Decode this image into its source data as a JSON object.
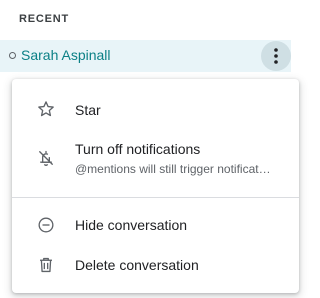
{
  "section": {
    "title": "RECENT"
  },
  "room": {
    "name": "Sarah Aspinall"
  },
  "menu": {
    "items": [
      {
        "label": "Star",
        "icon": "star-outline-icon"
      },
      {
        "label": "Turn off notifications",
        "sublabel": "@mentions will still trigger notifications",
        "icon": "bell-off-icon"
      },
      {
        "label": "Hide conversation",
        "icon": "minus-circle-icon"
      },
      {
        "label": "Delete conversation",
        "icon": "trash-icon"
      }
    ]
  },
  "colors": {
    "accent": "#0b8086",
    "row_highlight": "#e8f4f8",
    "kebab_hover": "#cfdfe4",
    "text_primary": "#202124",
    "text_secondary": "#5f6368",
    "divider": "#dadce0"
  }
}
